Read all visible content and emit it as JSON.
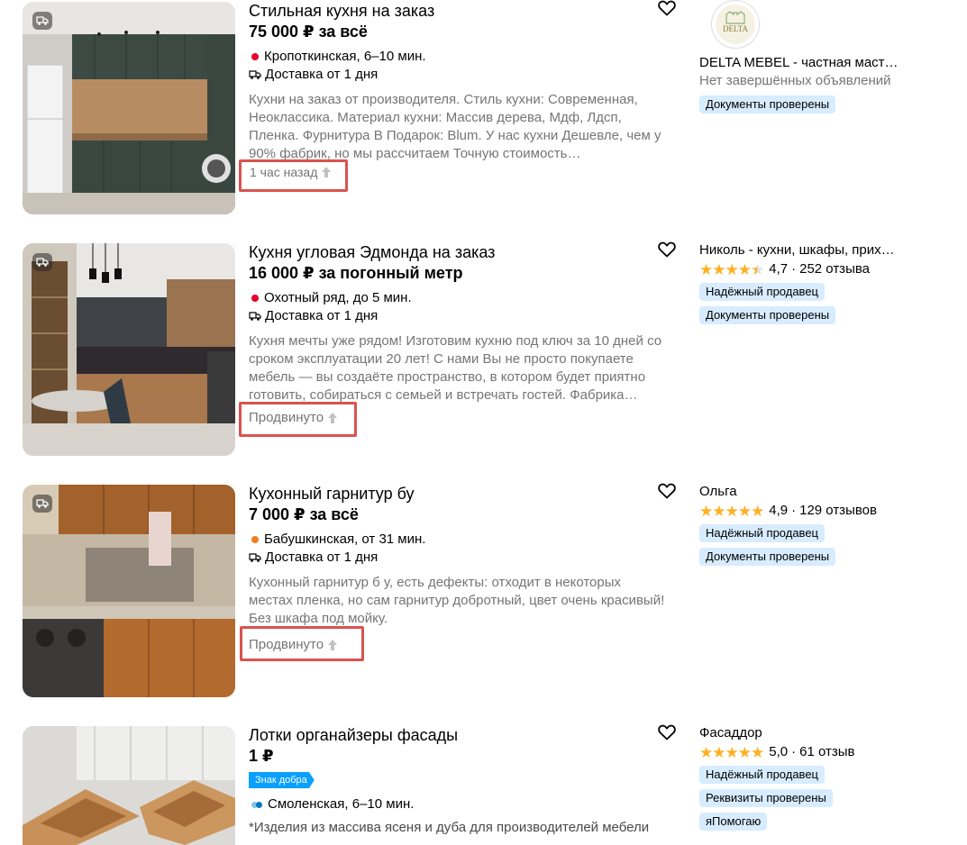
{
  "listings": [
    {
      "title": "Стильная кухня на заказ",
      "price": "75 000 ₽ за всё",
      "metro": "Кропоткинская, 6–10 мин.",
      "metro_color": "#e4002b",
      "delivery": "Доставка от 1 дня",
      "description": "Кухни на заказ от производителя. Стиль кухни: Современная, Неоклассика. Материал кухни: Массив дерева, Мдф, Лдсп, Пленка. Фурнитура В Подарок: Blum. У нас кухни Дешевле, чем у 90% фабрик, но мы рассчитаем Точную стоимость…",
      "meta": "1 час назад",
      "seller": {
        "logo_text": "DELTA",
        "name": "DELTA MEBEL - частная маст…",
        "subtitle": "Нет завершённых объявлений",
        "badges": [
          "Документы проверены"
        ]
      }
    },
    {
      "title": "Кухня угловая Эдмонда на заказ",
      "price": "16 000 ₽ за погонный метр",
      "metro": "Охотный ряд, до 5 мин.",
      "metro_color": "#e4002b",
      "delivery": "Доставка от 1 дня",
      "description": "Кухня мечты уже рядом! Изготовим кухню под ключ за 10 дней со сроком эксплуатации 20 лет! С нами Вы не просто покупаете мебель — вы создаёте пространство, в котором будет приятно готовить, собираться с семьей и встречать гостей. Фабрика…",
      "meta": "Продвинуто",
      "seller": {
        "name": "Николь - кухни, шкафы, прих…",
        "rating": "4,7",
        "stars": 4.5,
        "reviews": "252 отзыва",
        "badges": [
          "Надёжный продавец",
          "Документы проверены"
        ]
      }
    },
    {
      "title": "Кухонный гарнитур бу",
      "price": "7 000 ₽ за всё",
      "metro": "Бабушкинская, от 31 мин.",
      "metro_color": "#f07e24",
      "delivery": "Доставка от 1 дня",
      "description": "Кухонный гарнитур б у, есть дефекты: отходит в некоторых местах пленка, но сам гарнитур добротный, цвет очень красивый! Без шкафа под мойку.",
      "meta": "Продвинуто",
      "seller": {
        "name": "Ольга",
        "rating": "4,9",
        "stars": 5,
        "reviews": "129 отзывов",
        "badges": [
          "Надёжный продавец",
          "Документы проверены"
        ]
      }
    },
    {
      "title": "Лотки органайзеры фасады",
      "price": "1 ₽",
      "charity": "Знак добра",
      "metro": "Смоленская, 6–10 мин.",
      "metro_colors": [
        "#0078be",
        "#7fc6e8"
      ],
      "description": "*Изделия из массива ясеня и дуба для производителей мебели",
      "seller": {
        "name": "Фасаддор",
        "rating": "5,0",
        "stars": 5,
        "reviews": "61 отзыв",
        "badges": [
          "Надёжный продавец",
          "Реквизиты проверены",
          "яПомогаю"
        ]
      }
    }
  ],
  "rating_separator": "·",
  "icons": [
    "truck-icon",
    "heart-icon",
    "up-arrow-icon",
    "star-icon"
  ]
}
